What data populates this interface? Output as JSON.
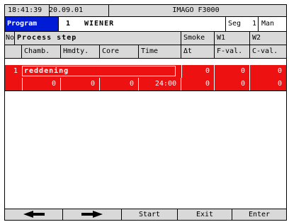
{
  "status": {
    "time": "18:41:39",
    "date": "20.09.01",
    "device": "IMAGO F3000"
  },
  "program": {
    "label": "Program",
    "number": "1",
    "name": "WIENER",
    "seg_label": "Seg",
    "seg_value": "1",
    "mode": "Man"
  },
  "table_header_row1": {
    "no": "No",
    "process_step": "Process step",
    "smoke": "Smoke",
    "w1": "W1",
    "w2": "W2"
  },
  "table_header_row2": {
    "chamb": "Chamb.",
    "hmdty": "Hmdty.",
    "core": "Core",
    "time": "Time",
    "dt": "Δt",
    "fval": "F-val.",
    "cval": "C-val."
  },
  "steps": [
    {
      "no": "1",
      "name": "reddening",
      "smoke": "0",
      "w1": "0",
      "w2": "0",
      "chamb": "0",
      "hmdty": "0",
      "core": "0",
      "time": "24:00",
      "dt": "0",
      "fval": "0",
      "cval": "0"
    }
  ],
  "footer": {
    "left_icon": "left-arrow-icon",
    "right_icon": "right-arrow-icon",
    "start": "Start",
    "exit": "Exit",
    "enter": "Enter"
  },
  "colors": {
    "program_bg": "#001bd6",
    "row_red": "#ee1111",
    "panel_gray": "#d9d9d9"
  }
}
